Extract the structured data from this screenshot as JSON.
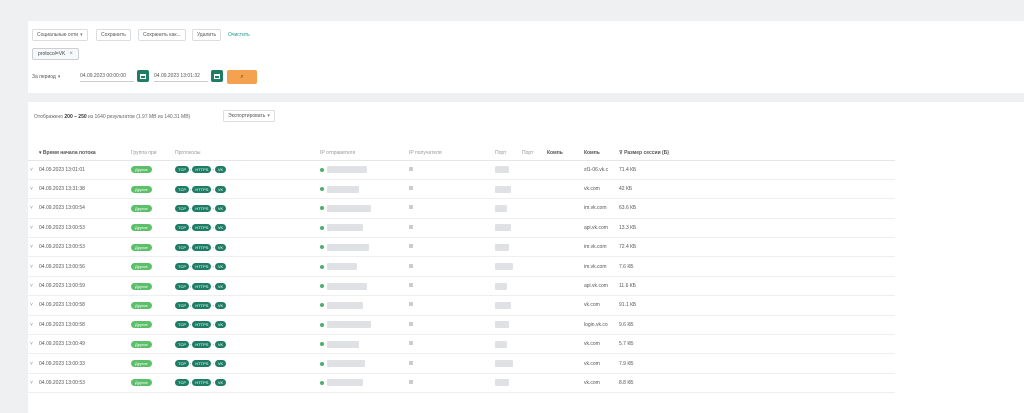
{
  "toolbar": {
    "social_label": "Социальные сети",
    "save_label": "Сохранить",
    "save_as_label": "Сохранить как...",
    "delete_label": "Удалить",
    "clear_label": "Очистить"
  },
  "filter_chip": {
    "text": "protocol=VK"
  },
  "period": {
    "label": "За период",
    "from": "04.09.2023  00:00:00",
    "to": "04.09.2023  13:01:32"
  },
  "results": {
    "summary_prefix": "Отображено",
    "range": "200 – 250",
    "summary_middle": "из 1640 результатов",
    "size_text": "(1.97 MB из 140.31 MB)",
    "export_label": "Экспортировать"
  },
  "columns": {
    "start_time": "Время начала потока",
    "app_group": "Группа при",
    "protocols": "Протоколы",
    "ip_sender": "IP отправителя",
    "ip_receiver": "IP получателя",
    "port1": "Порт",
    "port2": "Порт",
    "comp1": "Компь",
    "comp2": "Компь",
    "session_size": "Размер сессии (Б)"
  },
  "row_common": {
    "group": "Другое",
    "proto_tcp": "TCP",
    "proto_https": "HTTPS",
    "proto_vk": "VK"
  },
  "rows": [
    {
      "time": "04.09.2023 13:01:01",
      "host": "sf1-06.vk.c",
      "size": "71.4 КБ"
    },
    {
      "time": "04.09.2023 13:31:38",
      "host": "vk.com",
      "size": "42 КБ"
    },
    {
      "time": "04.09.2023 13:00:54",
      "host": "im.vk.com",
      "size": "63.6 КБ"
    },
    {
      "time": "04.09.2023 13:00:53",
      "host": "api.vk.com",
      "size": "13.3 КБ"
    },
    {
      "time": "04.09.2023 13:00:53",
      "host": "im.vk.com",
      "size": "72.4 КБ"
    },
    {
      "time": "04.09.2023 13:00:56",
      "host": "im.vk.com",
      "size": "7.6 КБ"
    },
    {
      "time": "04.09.2023 13:00:59",
      "host": "api.vk.com",
      "size": "11.6 КБ"
    },
    {
      "time": "04.09.2023 13:00:58",
      "host": "vk.com",
      "size": "91.1 КБ"
    },
    {
      "time": "04.09.2023 13:00:58",
      "host": "login.vk.co",
      "size": "9.6 КБ"
    },
    {
      "time": "04.09.2023 13:00:49",
      "host": "vk.com",
      "size": "5.7 КБ"
    },
    {
      "time": "04.09.2023 13:00:33",
      "host": "vk.com",
      "size": "7.9 КБ"
    },
    {
      "time": "04.09.2023 13:00:53",
      "host": "vk.com",
      "size": "8.8 КБ"
    }
  ]
}
